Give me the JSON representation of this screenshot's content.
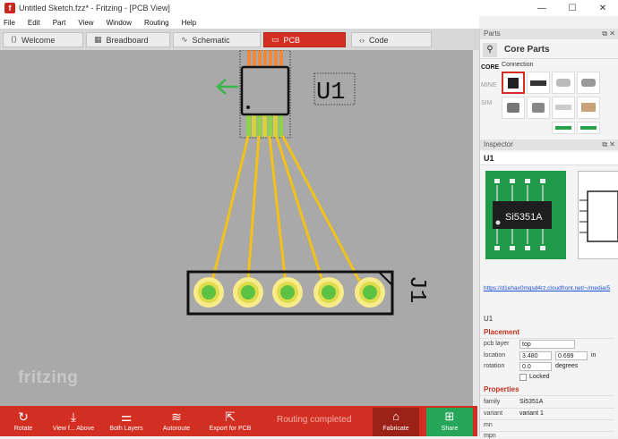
{
  "window": {
    "title": "Untitled Sketch.fzz* - Fritzing - [PCB View]",
    "app_icon": "f",
    "controls": [
      "—",
      "☐",
      "✕"
    ]
  },
  "menu": [
    "File",
    "Edit",
    "Part",
    "View",
    "Window",
    "Routing",
    "Help"
  ],
  "tabs": [
    {
      "label": "Welcome",
      "icon": "welcome-icon",
      "active": false
    },
    {
      "label": "Breadboard",
      "icon": "breadboard-icon",
      "active": false
    },
    {
      "label": "Schematic",
      "icon": "schematic-icon",
      "active": false
    },
    {
      "label": "PCB",
      "icon": "pcb-icon",
      "active": true
    },
    {
      "label": "Code",
      "icon": "code-icon",
      "active": false
    }
  ],
  "canvas": {
    "background": "#a9a9a9",
    "watermark": "fritzing",
    "chip_label": "U1",
    "header_label": "J1",
    "trace_color": "#f2c21b",
    "pad_color": "#5cc243",
    "ring_color": "#f8eb8c",
    "arrow_color": "#39b54a"
  },
  "toolbar": {
    "rotate": "Rotate",
    "view_from_above": "View f... Above",
    "both_layers": "Both Layers",
    "autoroute": "Autoroute",
    "export_pcb": "Export for PCB",
    "status": "Routing completed",
    "fabricate": "Fabricate",
    "share": "Share"
  },
  "parts": {
    "header": "Parts",
    "bin_title": "Core Parts",
    "bins": [
      "CORE",
      "MINE",
      "SIM"
    ],
    "section": "Connection"
  },
  "inspector": {
    "header": "Inspector",
    "title": "U1",
    "chip_text": "Si5351A",
    "link": "https://d1ehax0mqsd4rz.cloudfront.net/~/media/5",
    "instance": "U1",
    "placement_title": "Placement",
    "pcb_layer_label": "pcb layer",
    "pcb_layer_value": "top",
    "location_label": "location",
    "location_x": "3.480",
    "location_y": "0.699",
    "location_unit": "in",
    "rotation_label": "rotation",
    "rotation_value": "0.0",
    "rotation_unit": "degrees",
    "locked_label": "Locked",
    "properties_title": "Properties",
    "family_label": "family",
    "family_value": "Si5351A",
    "variant_label": "variant",
    "variant_value": "variant 1",
    "mn_label": "mn",
    "mpn_label": "mpn"
  }
}
